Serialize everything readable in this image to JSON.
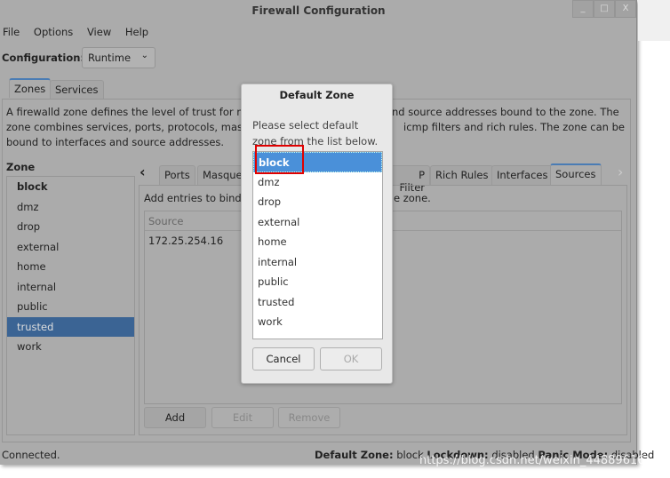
{
  "window": {
    "title": "Firewall Configuration",
    "controls": [
      "_",
      "□",
      "X"
    ]
  },
  "menu": [
    "File",
    "Options",
    "View",
    "Help"
  ],
  "configuration": {
    "label": "Configuration:",
    "value": "Runtime"
  },
  "main_tabs": [
    "Zones",
    "Services"
  ],
  "description": "A firewalld zone defines the level of trust for network connections, interfaces and source addresses bound to the zone. The zone combines services, ports, protocols, masquerading, port/packet forwarding, icmp filters and rich rules. The zone can be bound to interfaces and source addresses.",
  "description_visible": [
    "A firewalld zone defines the level of trust for ne",
    "nd source addresses bound to the zone. The",
    "zone combines services, ports, protocols, masqu",
    "icmp filters and rich rules. The zone can be",
    "bound to interfaces and source addresses."
  ],
  "zones": {
    "header": "Zone",
    "items": [
      "block",
      "dmz",
      "drop",
      "external",
      "home",
      "internal",
      "public",
      "trusted",
      "work"
    ],
    "selected": "trusted"
  },
  "zone_tabs": [
    "Ports",
    "Masque",
    "P Filter",
    "Rich Rules",
    "Interfaces",
    "Sources"
  ],
  "zone_tabs_active": "Sources",
  "sources": {
    "hint_left": "Add entries to bind s",
    "hint_right": "e zone.",
    "column": "Source",
    "rows": [
      "172.25.254.16"
    ],
    "buttons": {
      "add": "Add",
      "edit": "Edit",
      "remove": "Remove"
    }
  },
  "status": {
    "left": "Connected.",
    "default_zone_label": "Default Zone:",
    "default_zone": "block",
    "lockdown_label": "Lockdown:",
    "lockdown": "disabled",
    "panic_label": "Panic Mode:",
    "panic": "disabled"
  },
  "watermark": "https://blog.csdn.net/weixin_44889616",
  "dialog": {
    "title": "Default Zone",
    "prompt_line1": "Please select default",
    "prompt_line2": "zone from the list below.",
    "items": [
      "block",
      "dmz",
      "drop",
      "external",
      "home",
      "internal",
      "public",
      "trusted",
      "work"
    ],
    "selected": "block",
    "cancel": "Cancel",
    "ok": "OK"
  },
  "colors": {
    "selection": "#4a90d9",
    "highlight_box": "#e00000"
  }
}
